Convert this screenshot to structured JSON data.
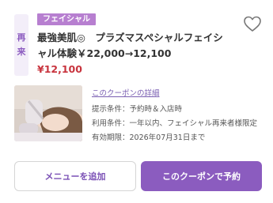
{
  "coupon": {
    "side_badge": [
      "再",
      "来"
    ],
    "category": "フェイシャル",
    "title": "最強美肌◎　プラズマスペシャルフェイシャル体験￥22,000→12,100",
    "price": "¥12,100",
    "detail_link": "このクーポンの詳細",
    "conditions": [
      "提示条件：予約時＆入店時",
      "利用条件：一年以内、フェイシャル再来者様限定",
      "有効期限：2026年07月31日まで"
    ]
  },
  "actions": {
    "add_menu": "メニューを追加",
    "reserve": "このクーポンで予約"
  },
  "colors": {
    "accent": "#8b5cbf",
    "tag": "#b77fd0",
    "price": "#c8343e"
  },
  "icons": {
    "favorite": "heart-outline-icon"
  }
}
